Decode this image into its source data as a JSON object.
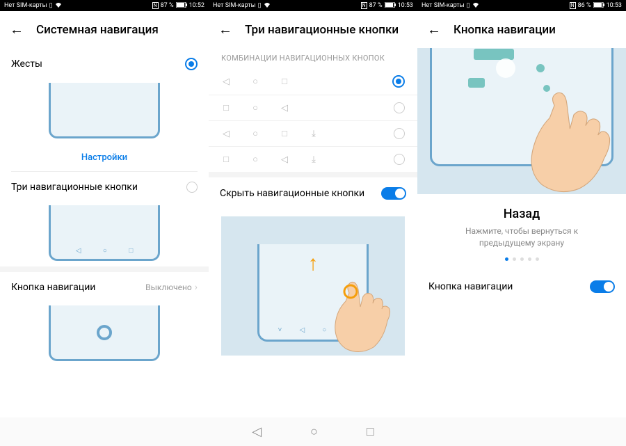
{
  "statusbars": [
    {
      "sim": "Нет SIM-карты",
      "battery_pct": "87 %",
      "time": "10:52"
    },
    {
      "sim": "Нет SIM-карты",
      "battery_pct": "87 %",
      "time": "10:53"
    },
    {
      "sim": "Нет SIM-карты",
      "battery_pct": "86 %",
      "time": "10:53"
    }
  ],
  "screen1": {
    "title": "Системная навигация",
    "gestures_label": "Жесты",
    "settings_link": "Настройки",
    "three_buttons_label": "Три навигационные кнопки",
    "nav_button_label": "Кнопка навигации",
    "nav_button_status": "Выключено"
  },
  "screen2": {
    "title": "Три навигационные кнопки",
    "section_title": "КОМБИНАЦИИ НАВИГАЦИОННЫХ КНОПОК",
    "hide_label": "Скрыть навигационные кнопки"
  },
  "screen3": {
    "title": "Кнопка навигации",
    "tutorial_title": "Назад",
    "tutorial_desc": "Нажмите, чтобы вернуться к предыдущему экрану",
    "toggle_label": "Кнопка навигации"
  },
  "nav_glyphs": {
    "back": "◁",
    "home": "○",
    "recents": "□",
    "dropdown": "⤓",
    "chev_down": "˅"
  }
}
